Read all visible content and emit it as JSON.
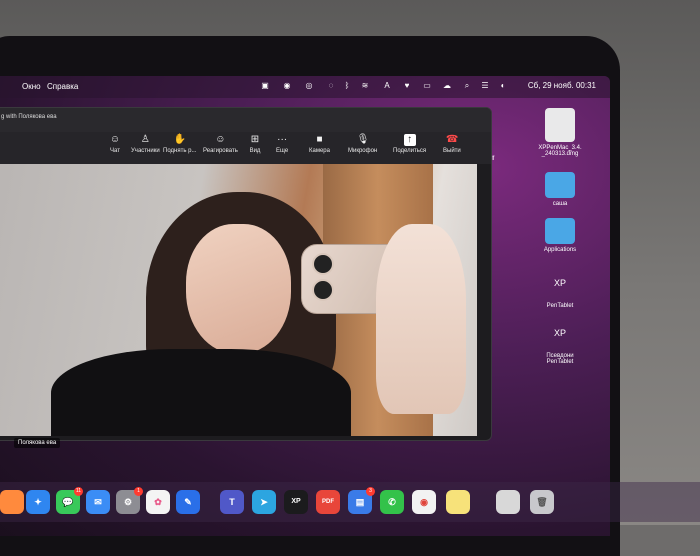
{
  "menubar": {
    "left_items": [
      "Окно",
      "Справка"
    ],
    "clock": "Сб, 29 нояб.  00:31"
  },
  "zoom": {
    "window_title": "g with Полякова ева",
    "participant_name": "Полякова ева",
    "toolbar": [
      {
        "label": "Чат",
        "icon": "chat-icon"
      },
      {
        "label": "Участники",
        "icon": "participants-icon"
      },
      {
        "label": "Поднять р...",
        "icon": "raise-hand-icon"
      },
      {
        "label": "Реагировать",
        "icon": "react-icon"
      },
      {
        "label": "Вид",
        "icon": "view-icon"
      },
      {
        "label": "Еще",
        "icon": "more-icon"
      },
      {
        "label": "Камера",
        "icon": "camera-icon"
      },
      {
        "label": "Микрофон",
        "icon": "microphone-icon"
      },
      {
        "label": "Поделиться",
        "icon": "share-icon"
      },
      {
        "label": "Выйти",
        "icon": "leave-icon"
      }
    ]
  },
  "desktop": {
    "items": [
      {
        "label": "XPPenMac_3.4.\n_240313.dmg",
        "icon": "dmg-file-icon"
      },
      {
        "label": "саша",
        "icon": "folder-icon"
      },
      {
        "label": "Applications",
        "icon": "applications-folder-icon"
      },
      {
        "label": "PenTablet",
        "icon": "xppen-icon"
      },
      {
        "label": "Псевдони\nPenTablet",
        "icon": "xppen-alias-icon"
      }
    ],
    "stray_label": "pdf"
  },
  "dock": {
    "badges": {
      "messages": "11",
      "settings": "1",
      "files": "3"
    }
  }
}
